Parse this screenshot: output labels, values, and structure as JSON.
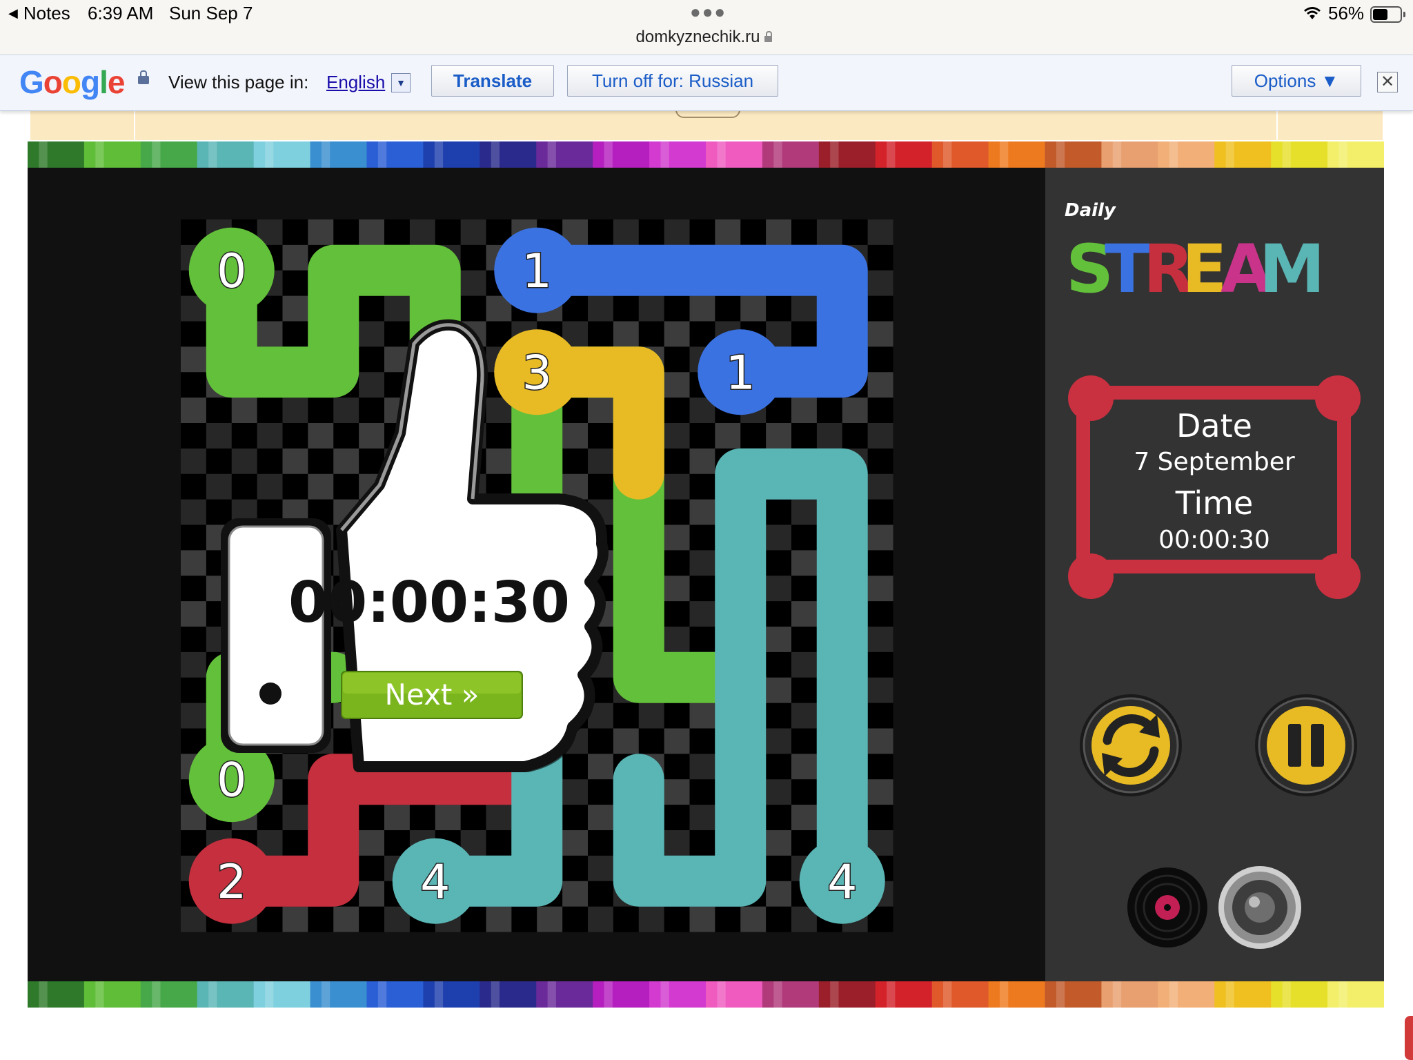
{
  "status_bar": {
    "back_label": "Notes",
    "time": "6:39 AM",
    "date": "Sun Sep 7",
    "url": "domkyznechik.ru",
    "battery": "56%",
    "battery_level": 0.56
  },
  "translate_bar": {
    "label": "View this page in:",
    "language": "English",
    "translate_button": "Translate",
    "turn_off_button": "Turn off for: Russian",
    "options_button": "Options ▼",
    "close": "✕"
  },
  "game": {
    "logo_small": "Daily",
    "logo_big": "STREAM",
    "date_label": "Date",
    "date_value": "7 September",
    "time_label": "Time",
    "time_value": "00:00:30",
    "result_time": "00:00:30",
    "next_button": "Next »",
    "grid_size": 7,
    "endpoints": [
      {
        "row": 0,
        "col": 0,
        "label": "0",
        "color": "green"
      },
      {
        "row": 5,
        "col": 0,
        "label": "0",
        "color": "green"
      },
      {
        "row": 0,
        "col": 3,
        "label": "1",
        "color": "blue"
      },
      {
        "row": 1,
        "col": 5,
        "label": "1",
        "color": "blue"
      },
      {
        "row": 6,
        "col": 0,
        "label": "2",
        "color": "red"
      },
      {
        "row": 1,
        "col": 3,
        "label": "3",
        "color": "yellow"
      },
      {
        "row": 6,
        "col": 2,
        "label": "4",
        "color": "teal"
      },
      {
        "row": 6,
        "col": 6,
        "label": "4",
        "color": "teal"
      }
    ],
    "colors": {
      "green": "#63c03a",
      "blue": "#3b72e2",
      "red": "#c52f3e",
      "yellow": "#e8bb25",
      "teal": "#5ab5b5",
      "panel_frame": "#c93040"
    },
    "icons": [
      "restart-icon",
      "pause-icon",
      "music-icon",
      "speaker-icon"
    ]
  }
}
